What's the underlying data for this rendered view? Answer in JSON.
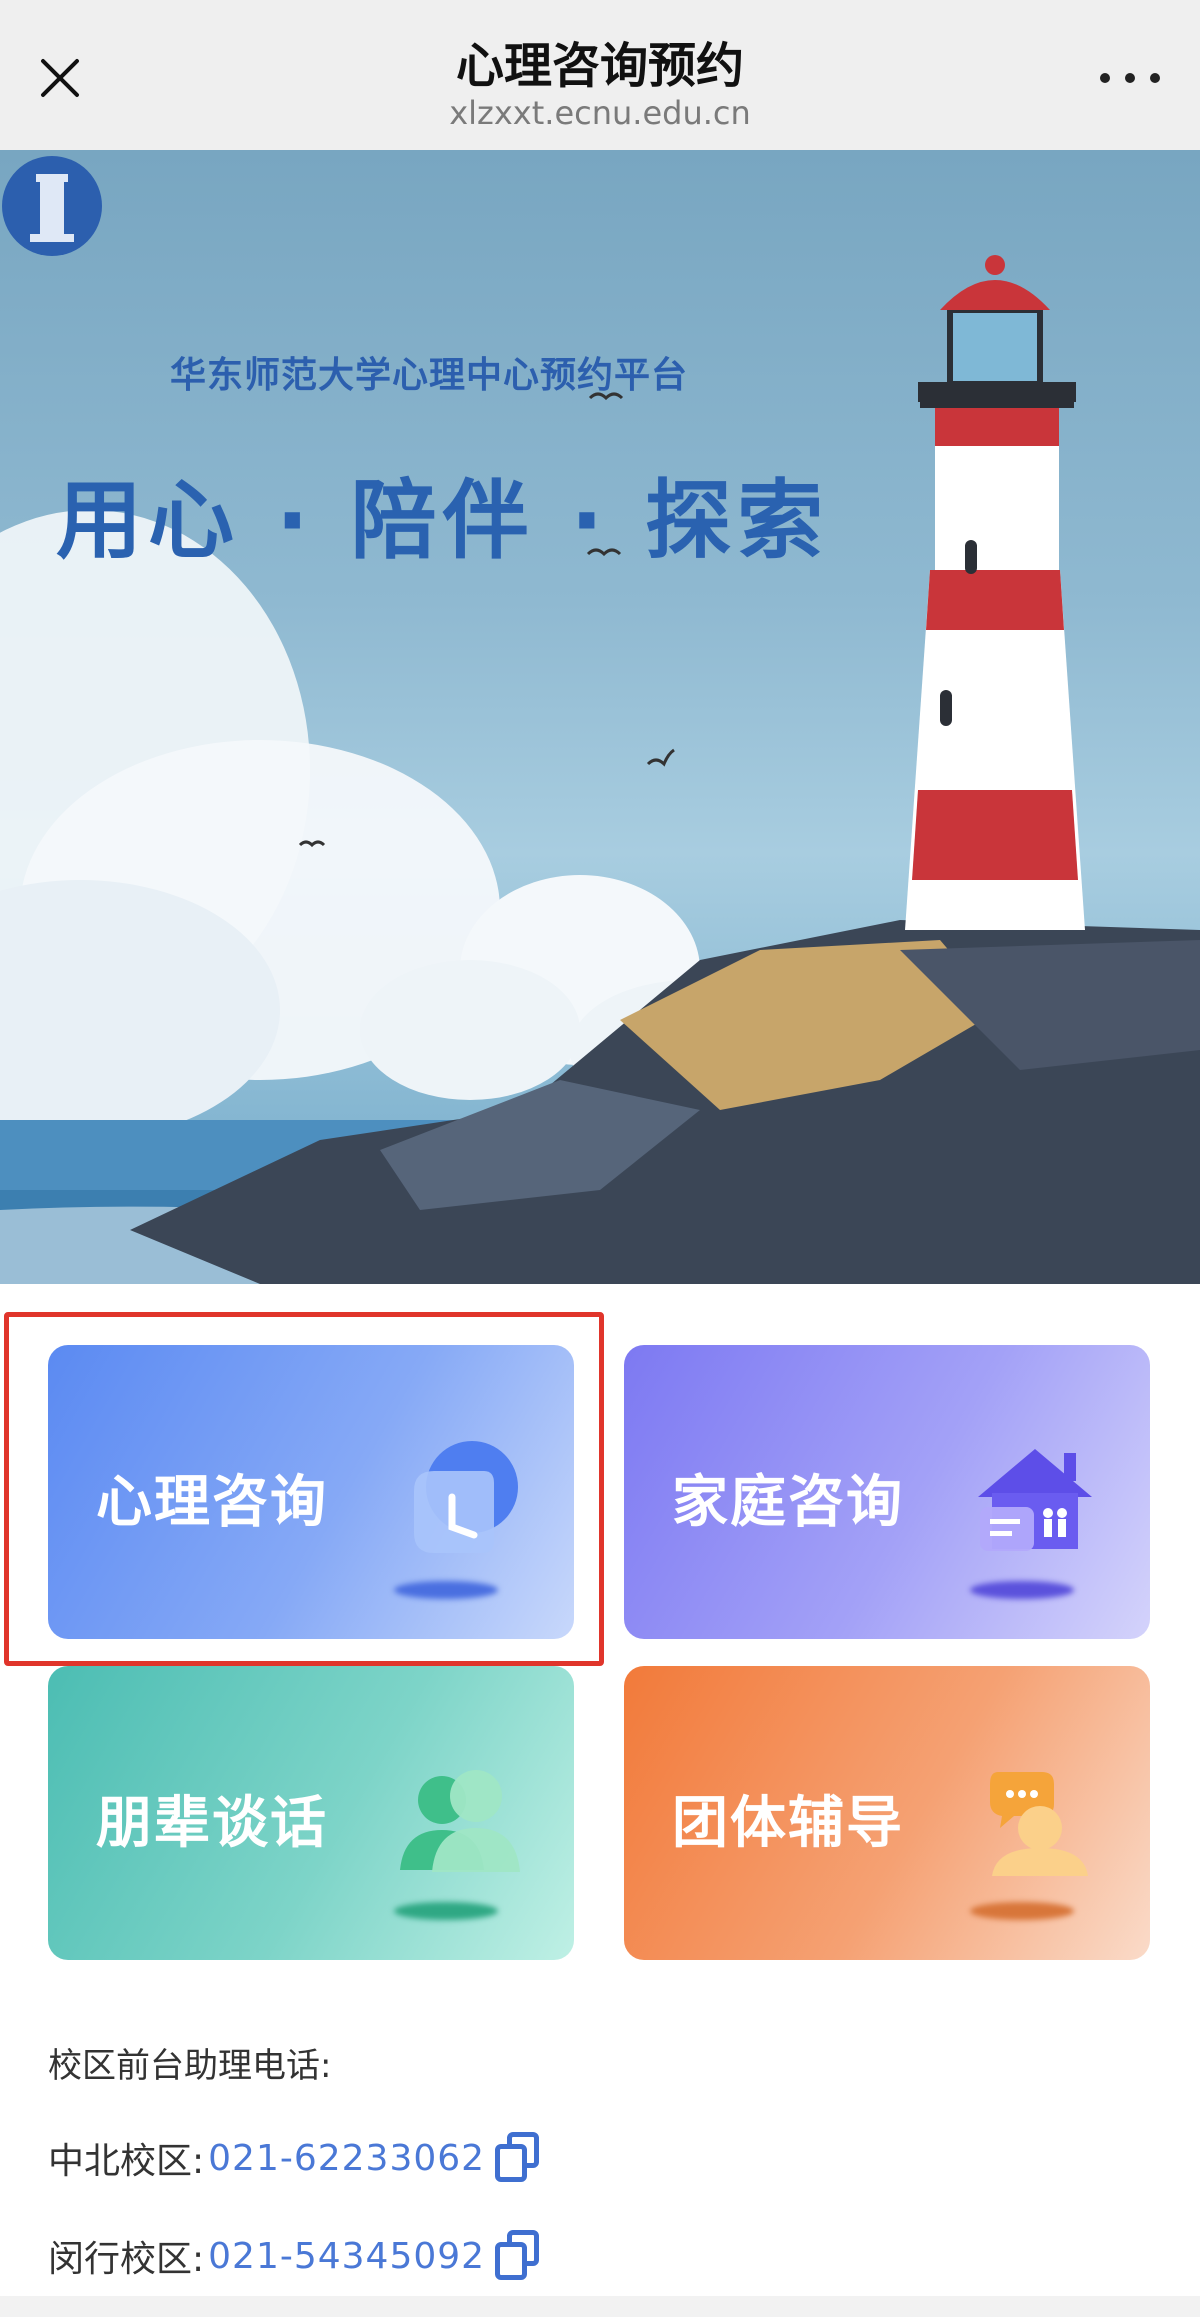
{
  "header": {
    "title": "心理咨询预约",
    "url": "xlzxxt.ecnu.edu.cn"
  },
  "banner": {
    "subtitle": "华东师范大学心理中心预约平台",
    "slogan": "用心 · 陪伴 · 探索"
  },
  "services": [
    {
      "label": "心理咨询",
      "icon": "clock-chat-icon"
    },
    {
      "label": "家庭咨询",
      "icon": "house-family-icon"
    },
    {
      "label": "朋辈谈话",
      "icon": "two-people-icon"
    },
    {
      "label": "团体辅导",
      "icon": "group-chat-icon"
    }
  ],
  "contact": {
    "title": "校区前台助理电话:",
    "rows": [
      {
        "campus": "中北校区:",
        "phone": "021-62233062"
      },
      {
        "campus": "闵行校区:",
        "phone": "021-54345092"
      }
    ]
  },
  "colors": {
    "highlight": "#e0352b",
    "phone_link": "#4a78d6",
    "banner_text": "#2a62b0"
  }
}
